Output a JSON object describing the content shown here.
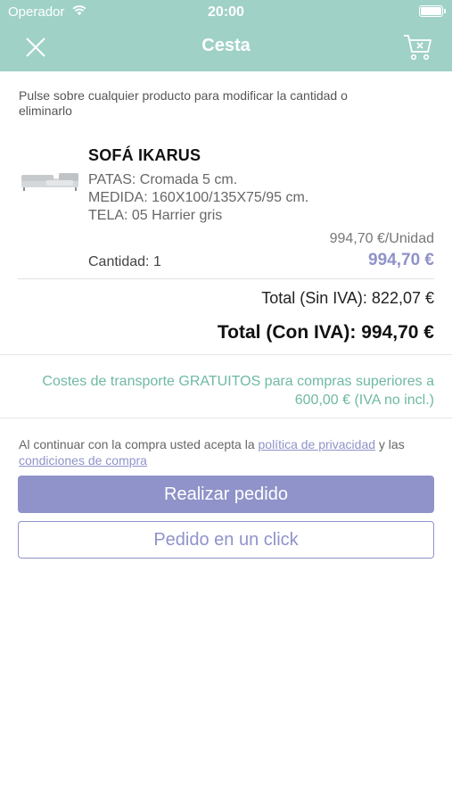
{
  "status_bar": {
    "carrier": "Operador",
    "time": "20:00"
  },
  "nav": {
    "title": "Cesta",
    "close_icon": "close-icon",
    "cart_icon": "cart-remove-icon"
  },
  "hint": "Pulse sobre cualquier producto para modificar la cantidad o eliminarlo",
  "cart_item": {
    "name": "SOFÁ IKARUS",
    "attributes": [
      "PATAS: Cromada 5 cm.",
      "MEDIDA: 160X100/135X75/95 cm.",
      "TELA: 05 Harrier gris"
    ],
    "unit_price": "994,70 €/Unidad",
    "quantity": "Cantidad: 1",
    "line_total": "994,70 €"
  },
  "totals": {
    "net": "Total (Sin IVA): 822,07 €",
    "gross": "Total (Con IVA): 994,70 €"
  },
  "shipping_notice": "Costes de transporte GRATUITOS para compras superiores a 600,00 € (IVA no incl.)",
  "terms": {
    "prefix": "Al continuar con la compra usted acepta la ",
    "privacy_link": "política de privacidad",
    "middle": " y las ",
    "conditions_link": "condiciones de compra"
  },
  "actions": {
    "place_order": "Realizar pedido",
    "one_click": "Pedido en un click"
  },
  "colors": {
    "header": "#9fd1c6",
    "accent": "#8f93c9",
    "shipping_text": "#6fb9a4"
  }
}
